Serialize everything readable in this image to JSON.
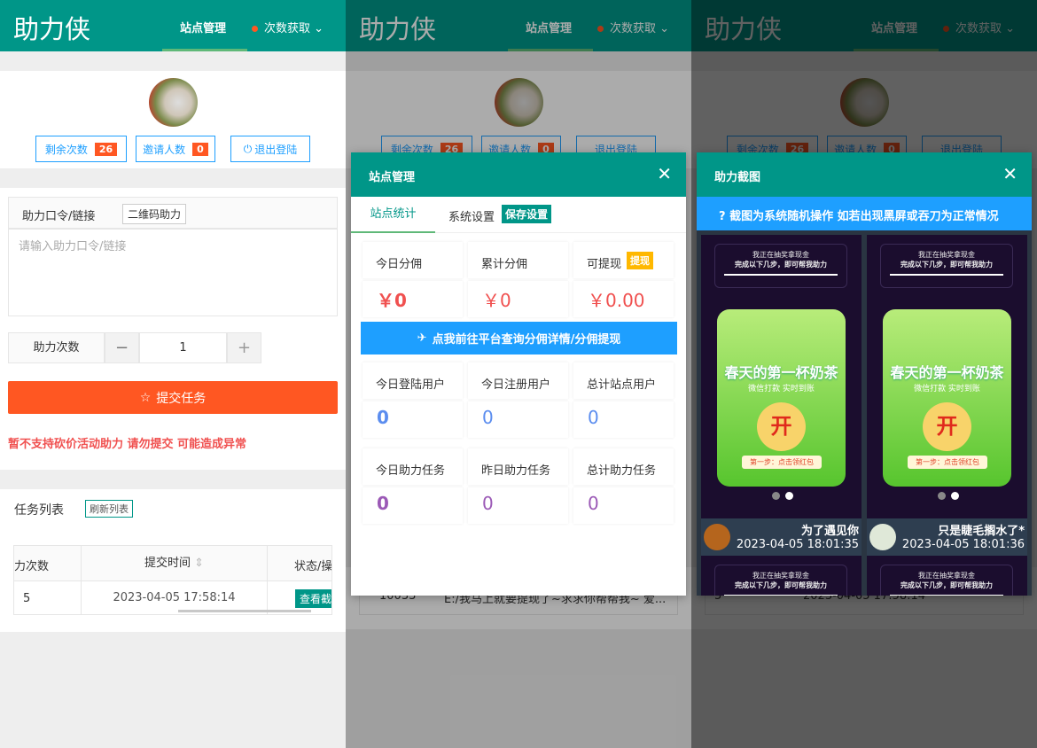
{
  "app": {
    "title": "助力侠",
    "nav_active": "站点管理",
    "nav_dropdown": "次数获取"
  },
  "profile": {
    "remaining_label": "剩余次数",
    "remaining": "26",
    "invite_label": "邀请人数",
    "invite": "0",
    "logout_label": "退出登陆"
  },
  "form": {
    "link_label": "助力口令/链接",
    "qr_button": "二维码助力",
    "placeholder": "请输入助力口令/链接",
    "count_label": "助力次数",
    "count_value": "1",
    "submit": "提交任务",
    "warning": "暂不支持砍价活动助力 请勿提交 可能造成异常"
  },
  "tasks": {
    "title": "任务列表",
    "refresh": "刷新列表",
    "columns": [
      "力次数",
      "提交时间",
      "状态/操"
    ],
    "rows": [
      {
        "count": "5",
        "time": "2023-04-05 17:58:14",
        "action": "查看截"
      }
    ],
    "bg_row": {
      "id": "10033",
      "text": "E:/我马上就要提现了~求求你帮帮我~ 爱..."
    }
  },
  "site_modal": {
    "title": "站点管理",
    "tabs": [
      "站点统计",
      "系统设置"
    ],
    "save": "保存设置",
    "withdraw_badge": "提现",
    "money": [
      {
        "label": "今日分佣",
        "value": "￥0"
      },
      {
        "label": "累计分佣",
        "value": "￥0"
      },
      {
        "label": "可提现",
        "value": "￥0.00"
      }
    ],
    "link_button": "点我前往平台查询分佣详情/分佣提现",
    "users": [
      {
        "label": "今日登陆用户",
        "value": "0"
      },
      {
        "label": "今日注册用户",
        "value": "0"
      },
      {
        "label": "总计站点用户",
        "value": "0"
      }
    ],
    "tasks": [
      {
        "label": "今日助力任务",
        "value": "0"
      },
      {
        "label": "昨日助力任务",
        "value": "0"
      },
      {
        "label": "总计助力任务",
        "value": "0"
      }
    ]
  },
  "shot_modal": {
    "title": "助力截图",
    "notice": "截图为系统随机操作 如若出现黑屏或吞刀为正常情况",
    "shot_text": {
      "l1": "我正在抽奖拿现金",
      "l2": "完成以下几步，即可帮我助力",
      "title": "春天的第一杯奶茶",
      "sub": "微信打款 实时到账",
      "coin": "开",
      "step": "第一步：点击领红包"
    },
    "shots": [
      {
        "name": "为了遇见你",
        "time": "2023-04-05 18:01:35"
      },
      {
        "name": "只是睫毛搁水了*",
        "time": "2023-04-05 18:01:36"
      }
    ]
  },
  "colors": {
    "primary": "#009688",
    "accent": "#FF5722",
    "blue": "#1E9FFF"
  }
}
